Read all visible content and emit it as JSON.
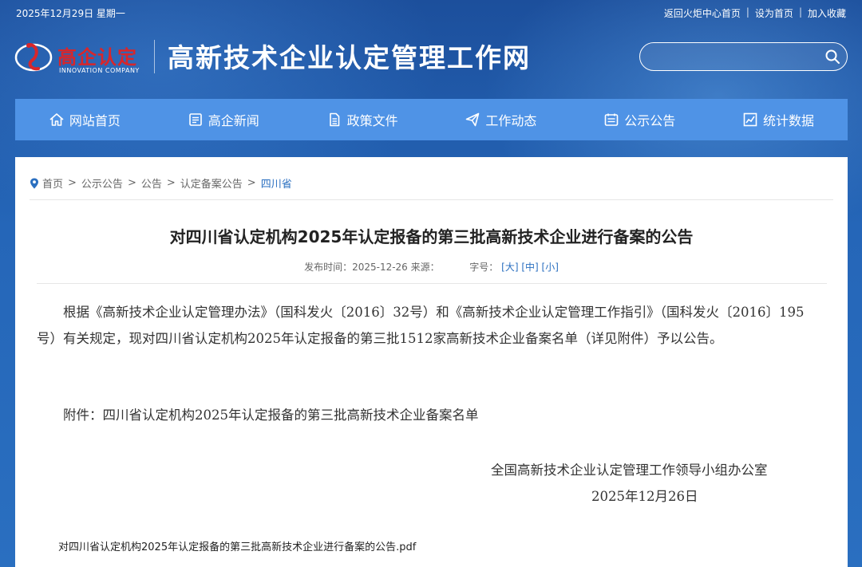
{
  "topbar": {
    "date": "2025年12月29日 星期一",
    "links": [
      "返回火炬中心首页",
      "设为首页",
      "加入收藏"
    ],
    "separator": "|"
  },
  "header": {
    "logo_cn": "高企认定",
    "logo_en": "INNOVATION COMPANY",
    "site_title": "高新技术企业认定管理工作网",
    "search_placeholder": "",
    "logo_color": "#d8262b"
  },
  "nav": {
    "items": [
      {
        "label": "网站首页",
        "icon": "home-icon"
      },
      {
        "label": "高企新闻",
        "icon": "news-icon"
      },
      {
        "label": "政策文件",
        "icon": "document-icon"
      },
      {
        "label": "工作动态",
        "icon": "paper-plane-icon"
      },
      {
        "label": "公示公告",
        "icon": "announcement-icon"
      },
      {
        "label": "统计数据",
        "icon": "chart-icon"
      }
    ],
    "background": "#4f93e6"
  },
  "breadcrumb": {
    "items": [
      "首页",
      "公示公告",
      "公告",
      "认定备案公告"
    ],
    "current": "四川省",
    "separator": ">"
  },
  "article": {
    "title": "对四川省认定机构2025年认定报备的第三批高新技术企业进行备案的公告",
    "meta_publish": "发布时间：2025-12-26 来源：",
    "meta_fontsize_label": "字号：",
    "size_large": "[大]",
    "size_medium": "[中]",
    "size_small": "[小]",
    "body": "根据《高新技术企业认定管理办法》（国科发火〔2016〕32号）和《高新技术企业认定管理工作指引》（国科发火〔2016〕195号）有关规定，现对四川省认定机构2025年认定报备的第三批1512家高新技术企业备案名单（详见附件）予以公告。",
    "attachment": "附件：四川省认定机构2025年认定报备的第三批高新技术企业备案名单",
    "sign_org": "全国高新技术企业认定管理工作领导小组办公室",
    "sign_date": "2025年12月26日",
    "pdf_link": "对四川省认定机构2025年认定报备的第三批高新技术企业进行备案的公告.pdf"
  }
}
